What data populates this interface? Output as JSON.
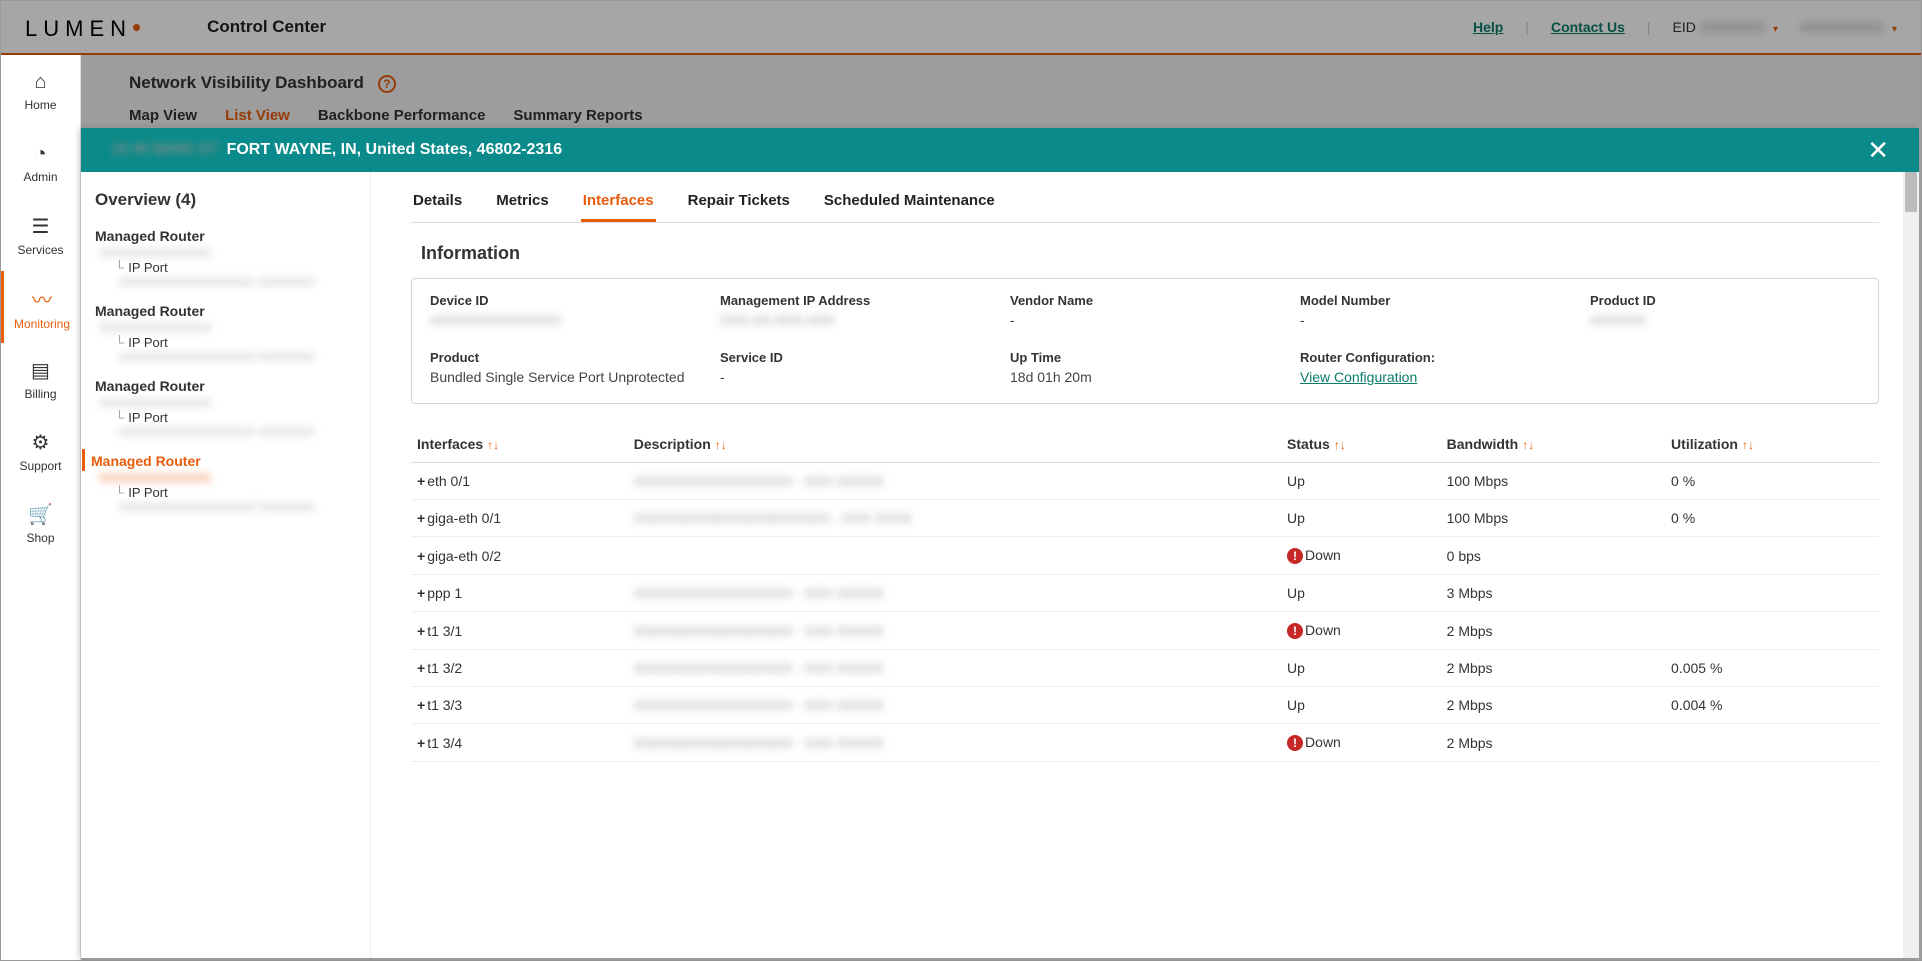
{
  "topbar": {
    "logo_text": "LUMEN",
    "app_title": "Control Center",
    "help": "Help",
    "contact": "Contact Us",
    "eid_label": "EID",
    "eid_value": "XXXXXXX",
    "user_value": "XXXXXXXXX"
  },
  "sidebar": {
    "items": [
      {
        "label": "Home",
        "icon": "⌂"
      },
      {
        "label": "Admin",
        "icon": "◔"
      },
      {
        "label": "Services",
        "icon": "☰"
      },
      {
        "label": "Monitoring",
        "icon": "〰"
      },
      {
        "label": "Billing",
        "icon": "▤"
      },
      {
        "label": "Support",
        "icon": "⚙"
      },
      {
        "label": "Shop",
        "icon": "🛒"
      }
    ],
    "active_index": 3
  },
  "dash": {
    "title": "Network Visibility Dashboard",
    "tabs": [
      "Map View",
      "List View",
      "Backbone Performance",
      "Summary Reports"
    ],
    "active_index": 1
  },
  "panel": {
    "prefix_blur": "10 W MAIN ST",
    "location": "FORT WAYNE, IN, United States, 46802-2316"
  },
  "overview": {
    "title": "Overview (4)",
    "groups": [
      {
        "router": "Managed Router",
        "router_sub": "XXXXXXXXXXXXXX",
        "port": "IP Port",
        "port_sub": "XXXXXXXXXXXXXXXXX   XXXXXXX",
        "sel": false
      },
      {
        "router": "Managed Router",
        "router_sub": "XXXXXXXXXXXXXX",
        "port": "IP Port",
        "port_sub": "XXXXXXXXXXXXXXXXX   XXXXXXX",
        "sel": false
      },
      {
        "router": "Managed Router",
        "router_sub": "XXXXXXXXXXXXXX",
        "port": "IP Port",
        "port_sub": "XXXXXXXXXXXXXXXXX   XXXXXXX",
        "sel": false
      },
      {
        "router": "Managed Router",
        "router_sub": "XXXXXXXXXXXXXX",
        "port": "IP Port",
        "port_sub": "XXXXXXXXXXXXXXXXX   XXXXXXX",
        "sel": true
      }
    ]
  },
  "detail": {
    "tabs": [
      "Details",
      "Metrics",
      "Interfaces",
      "Repair Tickets",
      "Scheduled Maintenance"
    ],
    "active_index": 2,
    "info_title": "Information",
    "fields": {
      "device_id": {
        "label": "Device ID",
        "value": "XXXXXXXXXXXXXX",
        "blur": true
      },
      "mgmt_ip": {
        "label": "Management IP Address",
        "value": "XXX.XX.XXX.XXX",
        "blur": true
      },
      "vendor": {
        "label": "Vendor Name",
        "value": "-",
        "blur": false
      },
      "model": {
        "label": "Model Number",
        "value": "-",
        "blur": false
      },
      "product_id": {
        "label": "Product ID",
        "value": "XXXXXX",
        "blur": true
      },
      "product": {
        "label": "Product",
        "value": "Bundled Single Service Port Unprotected",
        "blur": false
      },
      "service_id": {
        "label": "Service ID",
        "value": "-",
        "blur": false
      },
      "uptime": {
        "label": "Up Time",
        "value": "18d 01h 20m",
        "blur": false
      },
      "router_cfg": {
        "label": "Router Configuration:",
        "link": "View Configuration"
      }
    },
    "columns": {
      "iface": "Interfaces",
      "desc": "Description",
      "status": "Status",
      "bw": "Bandwidth",
      "util": "Utilization"
    },
    "rows": [
      {
        "iface": "eth 0/1",
        "desc": "XXXXXXXXXXXXXXXXX - XXX XXXXX",
        "status": "Up",
        "down": false,
        "bw": "100 Mbps",
        "util": "0 %"
      },
      {
        "iface": "giga-eth 0/1",
        "desc": "XXXXXXXXXXXXXXXXXXXXX - XXX XXXX",
        "status": "Up",
        "down": false,
        "bw": "100 Mbps",
        "util": "0 %"
      },
      {
        "iface": "giga-eth 0/2",
        "desc": "",
        "status": "Down",
        "down": true,
        "bw": "0 bps",
        "util": ""
      },
      {
        "iface": "ppp 1",
        "desc": "XXXXXXXXXXXXXXXXX - XXX XXXXX",
        "status": "Up",
        "down": false,
        "bw": "3 Mbps",
        "util": ""
      },
      {
        "iface": "t1 3/1",
        "desc": "XXXXXXXXXXXXXXXXX - XXX XXXXX",
        "status": "Down",
        "down": true,
        "bw": "2 Mbps",
        "util": ""
      },
      {
        "iface": "t1 3/2",
        "desc": "XXXXXXXXXXXXXXXXX - XXX XXXXX",
        "status": "Up",
        "down": false,
        "bw": "2 Mbps",
        "util": "0.005 %"
      },
      {
        "iface": "t1 3/3",
        "desc": "XXXXXXXXXXXXXXXXX - XXX XXXXX",
        "status": "Up",
        "down": false,
        "bw": "2 Mbps",
        "util": "0.004 %"
      },
      {
        "iface": "t1 3/4",
        "desc": "XXXXXXXXXXXXXXXXX - XXX XXXXX",
        "status": "Down",
        "down": true,
        "bw": "2 Mbps",
        "util": ""
      }
    ]
  }
}
